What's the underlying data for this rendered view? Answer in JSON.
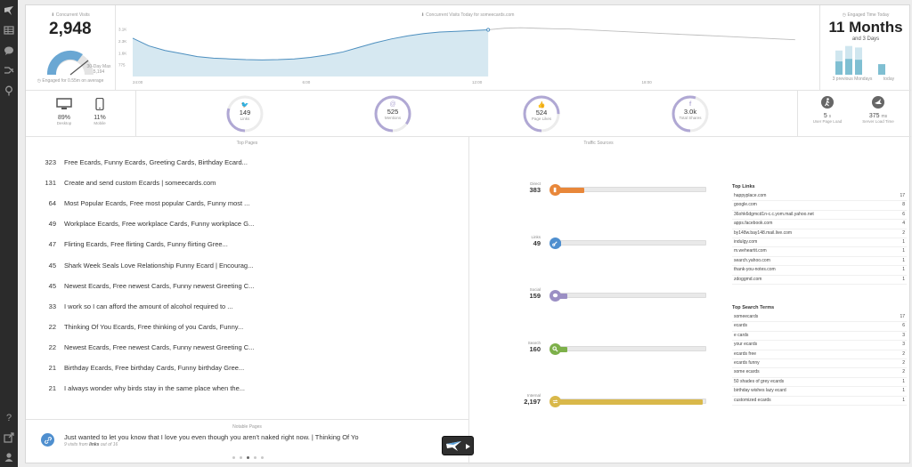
{
  "sidebar": {
    "icons": [
      "logo-icon",
      "grid-icon",
      "chat-icon",
      "share-icon",
      "pin-icon",
      "help-icon",
      "external-icon",
      "user-icon"
    ]
  },
  "concurrent": {
    "label": "Concurrent Visits",
    "value": "2,948",
    "max_label": "30-Day Max",
    "max_value": "5,194",
    "engaged_note": "Engaged for 0.55m on average"
  },
  "chart": {
    "title": "Concurrent Visits Today for someecards.com",
    "y_ticks": [
      "3.1K",
      "2.3K",
      "1.6K",
      "775"
    ],
    "x_ticks": [
      "24:00",
      "6:00",
      "12:00",
      "18:00"
    ]
  },
  "chart_data": {
    "type": "area",
    "title": "Concurrent Visits Today for someecards.com",
    "xlabel": "",
    "ylabel": "",
    "x_tick_labels": [
      "24:00",
      "6:00",
      "12:00",
      "18:00"
    ],
    "y_tick_labels": [
      "775",
      "1.6K",
      "2.3K",
      "3.1K"
    ],
    "ylim": [
      0,
      3600
    ],
    "series": [
      {
        "values_today": [
          2500,
          2000,
          1700,
          1500,
          1300,
          1200,
          1150,
          1100,
          1080,
          1100,
          1150,
          1250,
          1400,
          1600,
          1900,
          2200,
          2450,
          2650,
          2800,
          2900,
          2950,
          3000,
          3050
        ]
      },
      {
        "values_previous": [
          3050,
          3150,
          3180,
          3150,
          3120,
          3100,
          3050,
          3000,
          2950,
          2900,
          2850,
          2800,
          2750,
          2700,
          2650,
          2600,
          2550,
          2500,
          2450,
          2400
        ]
      }
    ],
    "current_point": 3050,
    "grid": false
  },
  "engaged_time": {
    "label": "Engaged Time Today",
    "value": "11 Months",
    "sub": "and 3 Days",
    "bar_labels": [
      "3 previous Mondays",
      "today"
    ],
    "bars_previous": [
      0.8,
      0.95,
      0.9
    ],
    "bars_today": 0.35
  },
  "devices": [
    {
      "pct": "89%",
      "label": "Desktop",
      "icon": "desktop-icon"
    },
    {
      "pct": "11%",
      "label": "Mobile",
      "icon": "mobile-icon"
    }
  ],
  "social": [
    {
      "value": "149",
      "label": "Links",
      "icon": "twitter-icon",
      "fraction": 0.3
    },
    {
      "value": "525",
      "label": "Mentions",
      "icon": "at-icon",
      "fraction": 0.85
    },
    {
      "value": "524",
      "label": "Page Likes",
      "icon": "thumbs-up-icon",
      "fraction": 0.75
    },
    {
      "value": "3.0k",
      "label": "Total Shares",
      "icon": "facebook-icon",
      "fraction": 0.55
    }
  ],
  "load": [
    {
      "value": "5",
      "unit": "s",
      "label": "User Page Load",
      "icon": "walker-icon"
    },
    {
      "value": "375",
      "unit": "ms",
      "label": "Server Load Time",
      "icon": "bird-icon"
    }
  ],
  "top_pages": {
    "heading": "Top Pages",
    "rows": [
      {
        "count": "323",
        "title": "Free Ecards, Funny Ecards, Greeting Cards, Birthday Ecard..."
      },
      {
        "count": "131",
        "title": "Create and send custom Ecards | someecards.com"
      },
      {
        "count": "64",
        "title": "Most Popular Ecards, Free most popular Cards, Funny most ..."
      },
      {
        "count": "49",
        "title": "Workplace Ecards, Free workplace Cards, Funny workplace G..."
      },
      {
        "count": "47",
        "title": "Flirting Ecards, Free flirting Cards, Funny flirting Gree..."
      },
      {
        "count": "45",
        "title": "Shark Week Seals Love Relationship Funny Ecard | Encourag..."
      },
      {
        "count": "45",
        "title": "Newest Ecards, Free newest Cards, Funny newest Greeting C..."
      },
      {
        "count": "33",
        "title": "I work so I can afford the amount of alcohol required to ..."
      },
      {
        "count": "22",
        "title": "Thinking Of You Ecards, Free thinking of you Cards, Funny..."
      },
      {
        "count": "22",
        "title": "Newest Ecards, Free newest Cards, Funny newest Greeting C..."
      },
      {
        "count": "21",
        "title": "Birthday Ecards, Free birthday Cards, Funny birthday Gree..."
      },
      {
        "count": "21",
        "title": "I always wonder why birds stay in the same place when the..."
      }
    ]
  },
  "notable": {
    "heading": "Notable Pages",
    "title": "Just wanted to let you know that I love you even though you aren't naked right now. | Thinking Of Yo",
    "sub_prefix": "9 visits from",
    "sub_bold": "links",
    "sub_suffix": "out of 16"
  },
  "traffic": {
    "heading": "Traffic Sources",
    "sources": [
      {
        "name": "Direct",
        "count": "383",
        "color": "#e8873a",
        "fraction": 0.2
      },
      {
        "name": "Links",
        "count": "49",
        "color": "#4f8fcf",
        "fraction": 0.03
      },
      {
        "name": "Social",
        "count": "159",
        "color": "#9b8fc4",
        "fraction": 0.09
      },
      {
        "name": "Search",
        "count": "160",
        "color": "#7db04a",
        "fraction": 0.09
      },
      {
        "name": "Internal",
        "count": "2,197",
        "color": "#d9b84a",
        "fraction": 0.97
      }
    ]
  },
  "top_links": {
    "heading": "Top Links",
    "rows": [
      {
        "name": "happyplace.com",
        "count": "17"
      },
      {
        "name": "google.com",
        "count": "8"
      },
      {
        "name": "36ohk6dgmcd1n-c.c.yom.mail.yahoo.net",
        "count": "6"
      },
      {
        "name": "apps.facebook.com",
        "count": "4"
      },
      {
        "name": "by148w.bay148.mail.live.com",
        "count": "2"
      },
      {
        "name": "indulgy.com",
        "count": "1"
      },
      {
        "name": "m.weheartit.com",
        "count": "1"
      },
      {
        "name": "search.yahoo.com",
        "count": "1"
      },
      {
        "name": "thank-you-notes.com",
        "count": "1"
      },
      {
        "name": "zdoggmd.com",
        "count": "1"
      }
    ]
  },
  "top_search": {
    "heading": "Top Search Terms",
    "rows": [
      {
        "name": "someecards",
        "count": "17"
      },
      {
        "name": "ecards",
        "count": "6"
      },
      {
        "name": "e cards",
        "count": "3"
      },
      {
        "name": "your ecards",
        "count": "3"
      },
      {
        "name": "ecards free",
        "count": "2"
      },
      {
        "name": "ecards funny",
        "count": "2"
      },
      {
        "name": "some ecards",
        "count": "2"
      },
      {
        "name": "50 shades of grey ecards",
        "count": "1"
      },
      {
        "name": "birthday wishes lazy ecard",
        "count": "1"
      },
      {
        "name": "customized ecards",
        "count": "1"
      }
    ]
  },
  "pager": {
    "count": 5,
    "active": 2
  }
}
